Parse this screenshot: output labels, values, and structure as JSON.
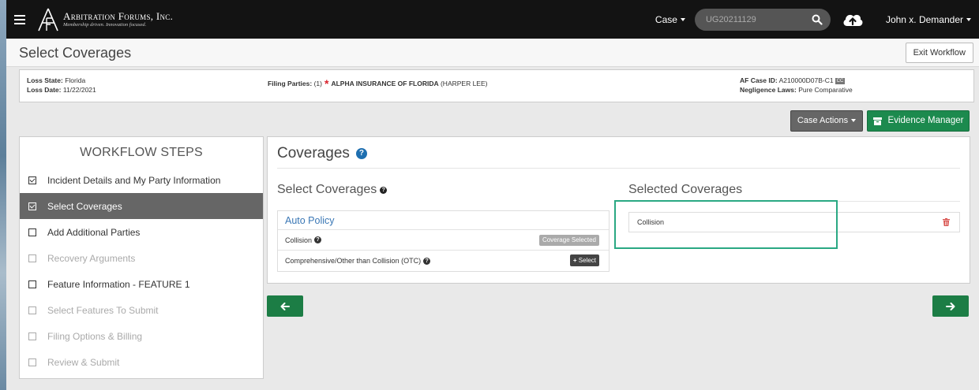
{
  "header": {
    "logo_name": "Arbitration Forums, Inc.",
    "logo_tagline": "Membership driven. Innovation focused.",
    "case_dropdown": "Case",
    "search_value": "UG20211129",
    "user_name": "John x. Demander"
  },
  "titlebar": {
    "title": "Select Coverages",
    "exit_label": "Exit Workflow"
  },
  "info": {
    "loss_state_label": "Loss State:",
    "loss_state": "Florida",
    "loss_date_label": "Loss Date:",
    "loss_date": "11/22/2021",
    "filing_parties_label": "Filing Parties:",
    "filing_parties_count": "(1)",
    "filing_party_name": "ALPHA INSURANCE OF FLORIDA",
    "filing_party_contact": "(HARPER LEE)",
    "case_id_label": "AF Case ID:",
    "case_id": "A210000D07B-C1",
    "cc_badge": "CC",
    "negligence_label": "Negligence Laws:",
    "negligence_value": "Pure Comparative"
  },
  "actions": {
    "case_actions_label": "Case Actions",
    "evidence_label": "Evidence Manager"
  },
  "workflow": {
    "title": "WORKFLOW STEPS",
    "steps": [
      {
        "label": "Incident Details and My Party Information",
        "state": "done"
      },
      {
        "label": "Select Coverages",
        "state": "active"
      },
      {
        "label": "Add Additional Parties",
        "state": "todo"
      },
      {
        "label": "Recovery Arguments",
        "state": "disabled"
      },
      {
        "label": "Feature Information - FEATURE 1",
        "state": "todo"
      },
      {
        "label": "Select Features To Submit",
        "state": "disabled"
      },
      {
        "label": "Filing Options & Billing",
        "state": "disabled"
      },
      {
        "label": "Review & Submit",
        "state": "disabled"
      }
    ]
  },
  "coverages": {
    "title": "Coverages",
    "select_title": "Select Coverages",
    "selected_title": "Selected Coverages",
    "policy_name": "Auto Policy",
    "items": [
      {
        "label": "Collision",
        "action": "Coverage Selected"
      },
      {
        "label": "Comprehensive/Other than Collision (OTC)",
        "action": "Select"
      }
    ],
    "selected_items": [
      "Collision"
    ]
  },
  "colors": {
    "topbar": "#131313",
    "accent_green": "#1c8a4e",
    "highlight": "#2aa883",
    "link_blue": "#3a77b5",
    "star_red": "#d9232d"
  },
  "icons": {
    "menu": "hamburger-menu-icon",
    "search": "search-icon",
    "upload": "cloud-upload-icon",
    "archive": "archive-icon",
    "help": "question-circle-icon",
    "delete": "trash-icon",
    "back": "arrow-left-icon",
    "next": "arrow-right-icon"
  }
}
